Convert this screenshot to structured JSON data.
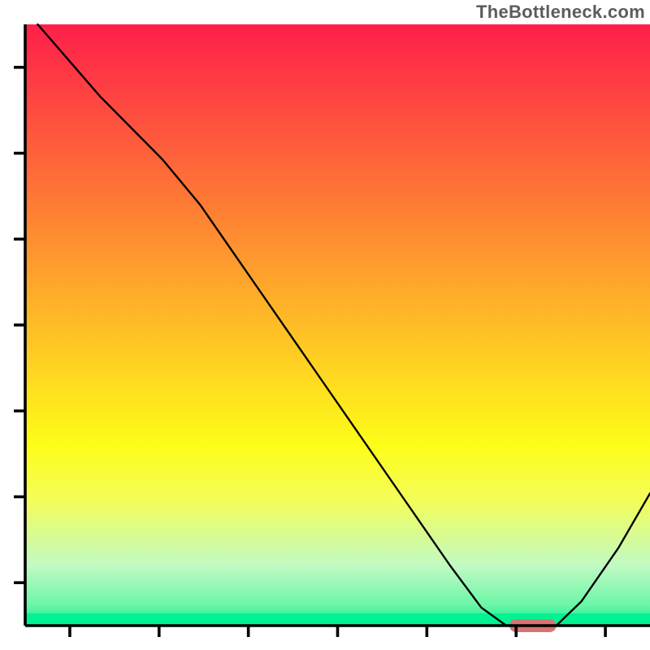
{
  "watermark": "TheBottleneck.com",
  "chart_data": {
    "type": "line",
    "title": "",
    "xlabel": "",
    "ylabel": "",
    "xlim": [
      0,
      100
    ],
    "ylim": [
      0,
      100
    ],
    "curve": [
      {
        "x": 2.0,
        "y": 100.0
      },
      {
        "x": 12.0,
        "y": 88.0
      },
      {
        "x": 22.0,
        "y": 77.5
      },
      {
        "x": 28.0,
        "y": 70.0
      },
      {
        "x": 38.0,
        "y": 55.0
      },
      {
        "x": 48.0,
        "y": 40.0
      },
      {
        "x": 58.0,
        "y": 25.0
      },
      {
        "x": 68.0,
        "y": 10.0
      },
      {
        "x": 73.0,
        "y": 3.0
      },
      {
        "x": 77.0,
        "y": 0.0
      },
      {
        "x": 85.0,
        "y": 0.0
      },
      {
        "x": 89.0,
        "y": 4.0
      },
      {
        "x": 95.0,
        "y": 13.0
      },
      {
        "x": 100.0,
        "y": 22.0
      }
    ],
    "marker": {
      "x_start": 77.5,
      "x_end": 85.0,
      "y": 0.0
    },
    "gradient_stops": [
      {
        "offset": 0.0,
        "color": "#fe1f4a"
      },
      {
        "offset": 0.14,
        "color": "#fe4a40"
      },
      {
        "offset": 0.28,
        "color": "#fe7536"
      },
      {
        "offset": 0.42,
        "color": "#fea32c"
      },
      {
        "offset": 0.56,
        "color": "#fed022"
      },
      {
        "offset": 0.7,
        "color": "#fdfd18"
      },
      {
        "offset": 0.79,
        "color": "#f4fd58"
      },
      {
        "offset": 0.9,
        "color": "#c1fac3"
      },
      {
        "offset": 0.965,
        "color": "#6df6a8"
      },
      {
        "offset": 1.0,
        "color": "#00f291"
      }
    ],
    "colors": {
      "axis": "#000000",
      "curve": "#000000",
      "marker": "#d77473",
      "watermark": "#5c5c5c"
    }
  }
}
